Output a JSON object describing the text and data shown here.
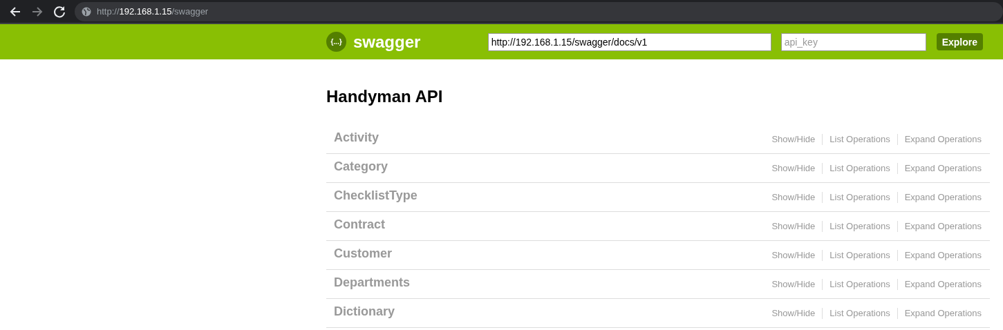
{
  "browser": {
    "address": {
      "scheme": "http://",
      "host": "192.168.1.15",
      "path": "/swagger"
    },
    "forward_disabled": true
  },
  "header": {
    "logo_text": "swagger",
    "logo_glyph": "{...}",
    "url_field": {
      "value": "http://192.168.1.15/swagger/docs/v1"
    },
    "api_key_field": {
      "placeholder": "api_key"
    },
    "explore_button": "Explore"
  },
  "title": "Handyman API",
  "resources": [
    {
      "name": "Activity",
      "actions": [
        "Show/Hide",
        "List Operations",
        "Expand Operations"
      ]
    },
    {
      "name": "Category",
      "actions": [
        "Show/Hide",
        "List Operations",
        "Expand Operations"
      ]
    },
    {
      "name": "ChecklistType",
      "actions": [
        "Show/Hide",
        "List Operations",
        "Expand Operations"
      ]
    },
    {
      "name": "Contract",
      "actions": [
        "Show/Hide",
        "List Operations",
        "Expand Operations"
      ]
    },
    {
      "name": "Customer",
      "actions": [
        "Show/Hide",
        "List Operations",
        "Expand Operations"
      ]
    },
    {
      "name": "Departments",
      "actions": [
        "Show/Hide",
        "List Operations",
        "Expand Operations"
      ]
    },
    {
      "name": "Dictionary",
      "actions": [
        "Show/Hide",
        "List Operations",
        "Expand Operations"
      ]
    }
  ]
}
